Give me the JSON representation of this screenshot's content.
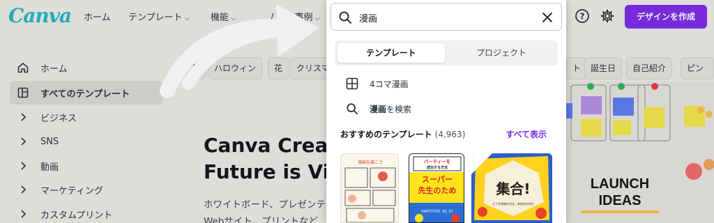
{
  "brand": {
    "logo": "Canva",
    "accent": "#7d2ae8",
    "logo_color": "#20b5c7"
  },
  "nav": {
    "items": [
      {
        "label": "ホーム",
        "chevron": false
      },
      {
        "label": "テンプレート",
        "chevron": true
      },
      {
        "label": "機能",
        "chevron": true
      },
      {
        "label": "/ 成功事例",
        "chevron": true
      }
    ],
    "create_label": "デザインを作成",
    "icons": [
      "help-icon",
      "settings-gear-icon"
    ]
  },
  "sidebar": {
    "items": [
      {
        "label": "ホーム",
        "icon": "home-icon",
        "active": false
      },
      {
        "label": "すべてのテンプレート",
        "icon": "template-layout-icon",
        "active": true
      },
      {
        "label": "ビジネス",
        "icon": "chevron-right-icon",
        "active": false
      },
      {
        "label": "SNS",
        "icon": "chevron-right-icon",
        "active": false
      },
      {
        "label": "動画",
        "icon": "chevron-right-icon",
        "active": false
      },
      {
        "label": "マーケティング",
        "icon": "chevron-right-icon",
        "active": false
      },
      {
        "label": "カスタムプリント",
        "icon": "chevron-right-icon",
        "active": false
      }
    ]
  },
  "chips": {
    "left": [
      "秋",
      "ハロウィン",
      "花",
      "クリスマ"
    ],
    "right": [
      "ト",
      "誕生日",
      "自己紹介",
      "ピンク"
    ]
  },
  "hero": {
    "title": "Canva Create\nFuture is Visu",
    "text": "ホワイトボード、プレゼンテ\nWebサイト、プリントなど"
  },
  "board": {
    "title_line1": "LAUNCH",
    "title_line2": "IDEAS"
  },
  "search": {
    "value": "漫画",
    "tabs": [
      "テンプレート",
      "プロジェクト"
    ],
    "active_tab": 0,
    "suggestions": [
      {
        "icon": "grid-template-icon",
        "prefix": "",
        "bold": "",
        "label": "4コマ漫画"
      },
      {
        "icon": "search-icon",
        "prefix": "",
        "bold": "漫画",
        "label": "を検索"
      }
    ],
    "recommended_label": "おすすめのテンプレート",
    "recommended_count": "(4,963)",
    "show_all": "すべて表示",
    "thumbs": [
      {
        "heading": "漫画を描こう",
        "bg": "#fbf6ea"
      },
      {
        "heading": "パーティーを\n成功する方法",
        "sub": "スーパー\n先生のため",
        "footer": "PARTYTIPS 03_07",
        "bg": "#ffe31a"
      },
      {
        "heading": "集合!",
        "sub": "どうぞ皆様の方法、参加をお待ち",
        "bg": "#ffd21f"
      }
    ]
  }
}
